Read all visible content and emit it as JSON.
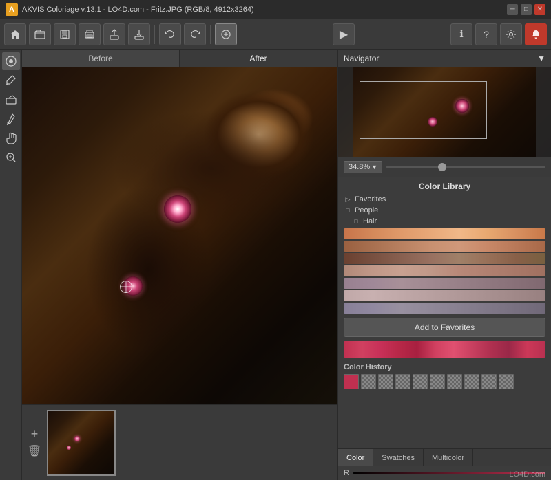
{
  "titlebar": {
    "title": "AKVIS Coloriage v.13.1 - LO4D.com - Fritz.JPG (RGB/8, 4912x3264)",
    "icon_text": "A",
    "minimize_label": "─",
    "maximize_label": "□",
    "close_label": "✕"
  },
  "toolbar": {
    "buttons": [
      {
        "name": "home",
        "icon": "⌂"
      },
      {
        "name": "open",
        "icon": "📁"
      },
      {
        "name": "save",
        "icon": "💾"
      },
      {
        "name": "print",
        "icon": "🖨"
      },
      {
        "name": "upload",
        "icon": "⬆"
      },
      {
        "name": "download",
        "icon": "⬇"
      },
      {
        "name": "back",
        "icon": "←"
      },
      {
        "name": "forward",
        "icon": "→"
      },
      {
        "name": "edit",
        "icon": "✎"
      }
    ],
    "play_icon": "▶",
    "info_icon": "ℹ",
    "help_icon": "?",
    "settings_icon": "⚙",
    "notification_icon": "🔔"
  },
  "left_tools": [
    {
      "name": "colorize",
      "icon": "🎨"
    },
    {
      "name": "brush",
      "icon": "✏"
    },
    {
      "name": "eraser",
      "icon": "⌫"
    },
    {
      "name": "eyedropper",
      "icon": "💉"
    },
    {
      "name": "hand",
      "icon": "✋"
    },
    {
      "name": "zoom",
      "icon": "🔍"
    }
  ],
  "canvas": {
    "before_label": "Before",
    "after_label": "After",
    "zoom_value": "34.8%"
  },
  "navigator": {
    "title": "Navigator",
    "dropdown_icon": "▼"
  },
  "color_library": {
    "title": "Color Library",
    "favorites_label": "Favorites",
    "people_label": "People",
    "hair_label": "Hair",
    "add_favorites_btn": "Add to Favorites",
    "color_history_label": "Color History"
  },
  "bottom_tabs": {
    "color_label": "Color",
    "swatches_label": "Swatches",
    "multicolor_label": "Multicolor",
    "r_label": "R"
  },
  "watermark": "LO4D.com"
}
